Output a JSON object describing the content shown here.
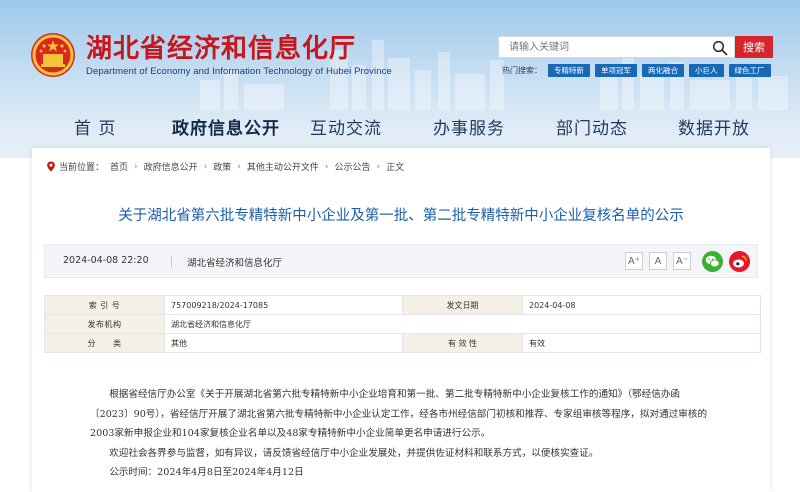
{
  "header": {
    "title_cn": "湖北省经济和信息化厅",
    "title_en": "Department of Economy and Information Technology of Hubei Province",
    "search": {
      "placeholder": "请输入关键词",
      "button_label": "搜索"
    },
    "hot_label": "热门搜索：",
    "hot_tags": [
      "专精特新",
      "单项冠军",
      "两化融合",
      "小巨人",
      "绿色工厂"
    ]
  },
  "nav": {
    "items": [
      "首 页",
      "政府信息公开",
      "互动交流",
      "办事服务",
      "部门动态",
      "数据开放"
    ],
    "active": "政府信息公开"
  },
  "breadcrumb": {
    "label": "当前位置：",
    "items": [
      "首页",
      "政府信息公开",
      "政策",
      "其他主动公开文件",
      "公示公告",
      "正文"
    ]
  },
  "article": {
    "title": "关于湖北省第六批专精特新中小企业及第一批、第二批专精特新中小企业复核名单的公示",
    "date": "2024-04-08 22:20",
    "source": "湖北省经济和信息化厅",
    "font_buttons": [
      "A⁺",
      "A",
      "A⁻"
    ],
    "share_icons": [
      "wechat-icon",
      "weibo-icon"
    ]
  },
  "info_table": {
    "rows": [
      {
        "k1": "索 引 号",
        "v1": "757009218/2024-17085",
        "k2": "发文日期",
        "v2": "2024-04-08"
      },
      {
        "k1": "发布机构",
        "v1": "湖北省经济和信息化厅",
        "k2": "",
        "v2": ""
      },
      {
        "k1": "分　　类",
        "v1": "其他",
        "k2": "有 效 性",
        "v2": "有效"
      }
    ]
  },
  "body": {
    "p1": "根据省经信厅办公室《关于开展湖北省第六批专精特新中小企业培育和第一批、第二批专精特新中小企业复核工作的通知》（鄂经信办函〔2023〕90号），省经信厅开展了湖北省第六批专精特新中小企业认定工作，经各市州经信部门初核和推荐、专家组审核等程序，拟对通过审核的2003家新申报企业和104家复核企业名单以及48家专精特新中小企业简单更名申请进行公示。",
    "p2": "欢迎社会各界参与监督，如有异议，请反馈省经信厅中小企业发展处，并提供佐证材料和联系方式，以便核实查证。",
    "p3": "公示时间：2024年4月8日至2024年4月12日"
  },
  "colors": {
    "brand_red": "#c8161d",
    "title_blue": "#1c5fa8",
    "tag_blue": "#1868b8",
    "search_red": "#d4252b"
  }
}
